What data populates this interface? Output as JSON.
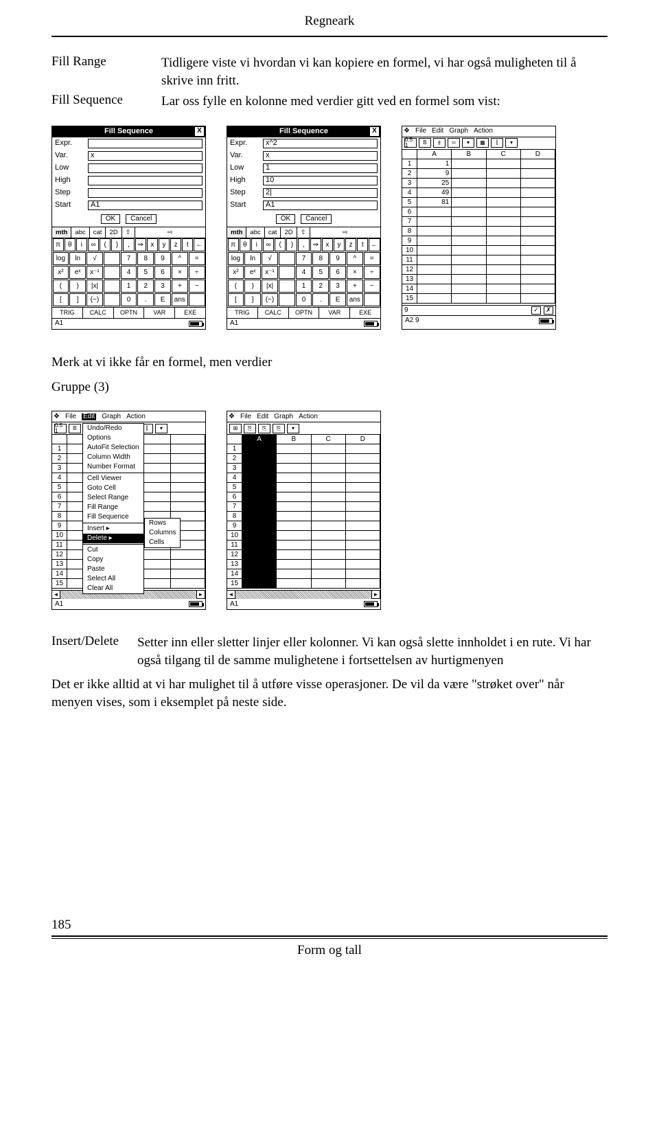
{
  "header": {
    "title": "Regneark"
  },
  "labels": {
    "fill_range": "Fill Range",
    "fill_sequence": "Fill Sequence",
    "insert_delete": "Insert/Delete"
  },
  "paras": {
    "p1": "Tidligere viste vi hvordan vi kan kopiere en formel, vi har også muligheten til å skrive inn fritt.",
    "p2": "Lar oss fylle en kolonne med verdier gitt ved en formel som vist:",
    "p3": "Merk at vi ikke får en formel, men verdier",
    "p4": "Gruppe (3)",
    "p5": "Setter inn eller sletter linjer eller kolonner. Vi kan også slette innholdet i en rute. Vi har også tilgang til de samme mulighetene i fortsettelsen av hurtigmenyen",
    "p6": "Det er ikke alltid at vi har mulighet til å utføre visse operasjoner. De vil da være \"strøket over\" når menyen vises, som i eksemplet på neste side."
  },
  "dialog": {
    "title": "Fill Sequence",
    "fields": [
      "Expr.",
      "Var.",
      "Low",
      "High",
      "Step",
      "Start"
    ],
    "empty": {
      "Expr.": "",
      "Var.": "x",
      "Low": "",
      "High": "",
      "Step": "",
      "Start": "A1"
    },
    "filled": {
      "Expr.": "x^2",
      "Var.": "x",
      "Low": "1",
      "High": "10",
      "Step": "2|",
      "Start": "A1"
    },
    "ok": "OK",
    "cancel": "Cancel"
  },
  "tabs": [
    "mth",
    "abc",
    "cat",
    "2D"
  ],
  "keypad": {
    "r1": [
      "π",
      "θ",
      "i",
      "∞",
      "(",
      ")",
      ",",
      "⇒",
      "x",
      "y",
      "z",
      "t",
      "←"
    ],
    "r2": [
      "log",
      "ln",
      "√",
      "",
      "7",
      "8",
      "9",
      "^",
      "="
    ],
    "r3": [
      "x²",
      "eˣ",
      "x⁻¹",
      "",
      "4",
      "5",
      "6",
      "×",
      "÷"
    ],
    "r4": [
      "(",
      ")",
      "|x|",
      "",
      "1",
      "2",
      "3",
      "+",
      "−"
    ],
    "r5": [
      "[",
      "]",
      "(−)",
      "",
      "0",
      ".",
      "E",
      "ans",
      ""
    ]
  },
  "fnkeys": [
    "TRIG",
    "CALC",
    "OPTN",
    "VAR",
    "EXE"
  ],
  "status": {
    "s1": "A1",
    "s2": "A1",
    "s3": "A2 9"
  },
  "menubar": {
    "items": [
      "File",
      "Edit",
      "Graph",
      "Action"
    ],
    "icon": "❖"
  },
  "toolbar_content": [
    "0.5 1",
    "B",
    "⫵",
    "═",
    "▾",
    "▦",
    "⫿",
    "▾"
  ],
  "sheet_cols": [
    "A",
    "B",
    "C",
    "D"
  ],
  "sheet3_values": {
    "1": "1",
    "2": "9",
    "3": "25",
    "4": "49",
    "5": "81"
  },
  "editbar3_text": "9",
  "edit_menu": {
    "items": [
      "Undo/Redo",
      "Options",
      "AutoFit Selection",
      "Column Width",
      "Number Format",
      "Cell Viewer",
      "Goto Cell",
      "Select Range",
      "Fill Range",
      "Fill Sequence",
      "Insert",
      "Delete",
      "Cut",
      "Copy",
      "Paste",
      "Select All",
      "Clear All"
    ],
    "submenu_parent": "Delete",
    "submenu": [
      "Rows",
      "Columns",
      "Cells"
    ]
  },
  "screen5_toolbar": [
    "⊞",
    "⎘",
    "⎘",
    "⎘",
    "▾"
  ],
  "footer": {
    "page": "185",
    "text": "Form og tall"
  }
}
